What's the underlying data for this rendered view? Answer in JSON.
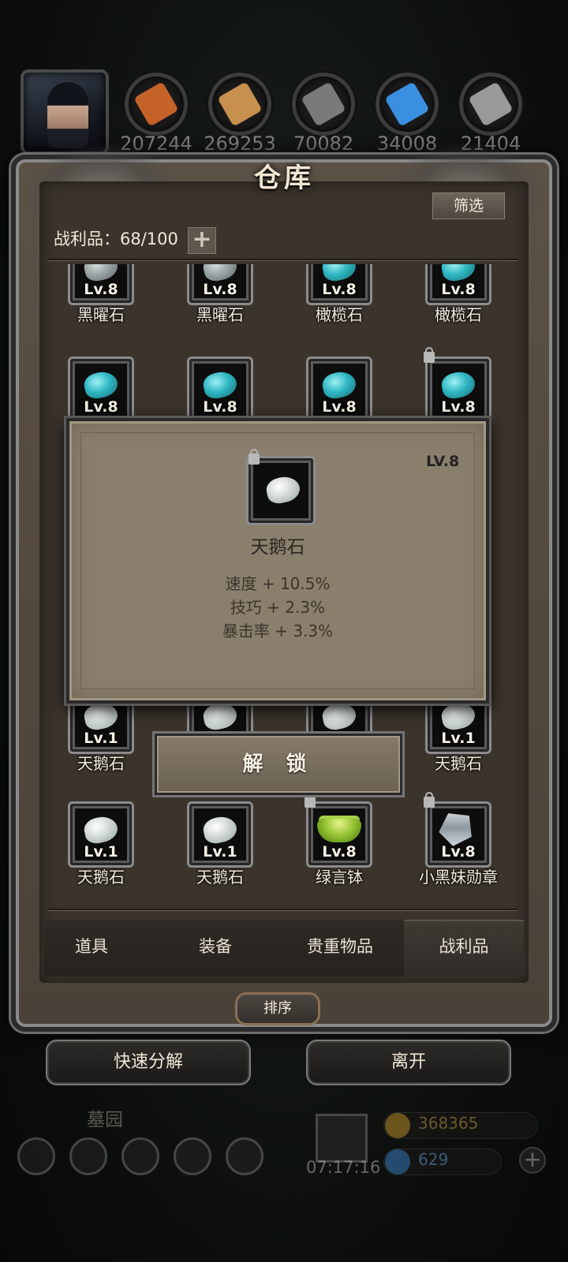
{
  "resources": {
    "values": [
      "207244",
      "269253",
      "70082",
      "34008",
      "21404"
    ],
    "colors": [
      "#c4622a",
      "#c8904e",
      "#7a7a7a",
      "#3a8fe0",
      "#9a9a9a"
    ],
    "icons": [
      "meat-icon",
      "wood-icon",
      "iron-ingot-icon",
      "crystal-icon",
      "steel-ingot-icon"
    ]
  },
  "warehouse": {
    "title": "仓库",
    "filter_label": "筛选",
    "capacity_label": "战利品：68/100",
    "plus_label": "+"
  },
  "grid": {
    "row1": [
      {
        "level": "Lv.8",
        "name": "黑曜石",
        "gem": "grey",
        "locked": false
      },
      {
        "level": "Lv.8",
        "name": "黑曜石",
        "gem": "grey",
        "locked": false
      },
      {
        "level": "Lv.8",
        "name": "橄榄石",
        "gem": "teal",
        "locked": false
      },
      {
        "level": "Lv.8",
        "name": "橄榄石",
        "gem": "teal",
        "locked": false
      }
    ],
    "row2": [
      {
        "level": "Lv.8",
        "gem": "teal",
        "locked": false
      },
      {
        "level": "Lv.8",
        "gem": "teal",
        "locked": false
      },
      {
        "level": "Lv.8",
        "gem": "teal",
        "locked": false
      },
      {
        "level": "Lv.8",
        "gem": "teal",
        "locked": true
      }
    ],
    "row3": [
      {
        "level": "Lv.1",
        "name": "天鹅石",
        "gem": "white",
        "locked": false
      },
      {
        "level": "",
        "name": "",
        "gem": "white",
        "locked": false
      },
      {
        "level": "",
        "name": "",
        "gem": "white",
        "locked": false
      },
      {
        "level": "Lv.1",
        "name": "天鹅石",
        "gem": "white",
        "locked": false
      }
    ],
    "row4": [
      {
        "level": "Lv.1",
        "name": "天鹅石",
        "gem": "white",
        "locked": false
      },
      {
        "level": "Lv.1",
        "name": "天鹅石",
        "gem": "white",
        "locked": false
      },
      {
        "level": "Lv.8",
        "name": "绿言钵",
        "icon": "green-bowl-icon",
        "locked": true
      },
      {
        "level": "Lv.8",
        "name": "小黑妹勋章",
        "icon": "medal-icon",
        "locked": true
      }
    ]
  },
  "popup": {
    "level": "LV.8",
    "name": "天鹅石",
    "stats": [
      "速度 + 10.5%",
      "技巧 + 2.3%",
      "暴击率 + 3.3%"
    ]
  },
  "unlock_label": "解 锁",
  "tabs": [
    "道具",
    "装备",
    "贵重物品",
    "战利品"
  ],
  "active_tab": "战利品",
  "sort_label": "排序",
  "quick_decompose_label": "快速分解",
  "leave_label": "离开",
  "background": {
    "location": "墓园",
    "timer": "07:17:16",
    "gold": "368365",
    "gems": "629"
  }
}
